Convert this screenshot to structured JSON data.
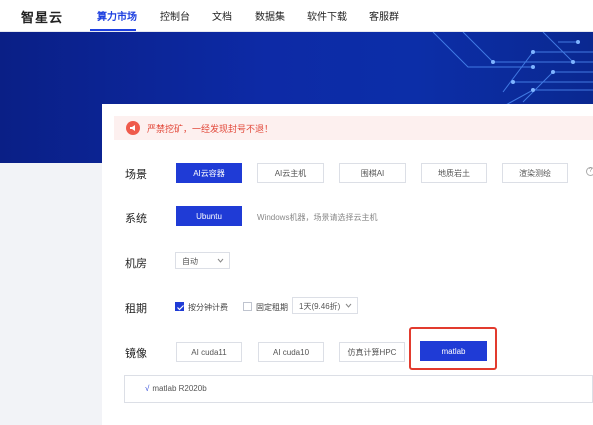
{
  "nav": {
    "brand": "智星云",
    "items": [
      "算力市场",
      "控制台",
      "文档",
      "数据集",
      "软件下载",
      "客服群"
    ]
  },
  "notice": {
    "text": "严禁挖矿，一经发现封号不退！"
  },
  "scene": {
    "label": "场景",
    "options": [
      "AI云容器",
      "AI云主机",
      "围棋AI",
      "地质岩土",
      "渲染测绘"
    ],
    "selected": "AI云容器"
  },
  "system": {
    "label": "系统",
    "option": "Ubuntu",
    "hint": "Windows机器，场景请选择云主机"
  },
  "room": {
    "label": "机房",
    "value": "自动"
  },
  "lease": {
    "label": "租期",
    "by_minute": "按分钟计费",
    "by_minute_checked": true,
    "fixed": "固定租期",
    "fixed_checked": false,
    "duration": "1天(9.46折)"
  },
  "image": {
    "label": "镜像",
    "options": [
      "AI cuda11",
      "AI cuda10",
      "仿真计算HPC",
      "matlab"
    ],
    "selected": "matlab",
    "version": "matlab R2020b"
  },
  "colors": {
    "primary": "#1f3bd6",
    "danger": "#e23b2e",
    "hero": "#0d2aa6"
  }
}
